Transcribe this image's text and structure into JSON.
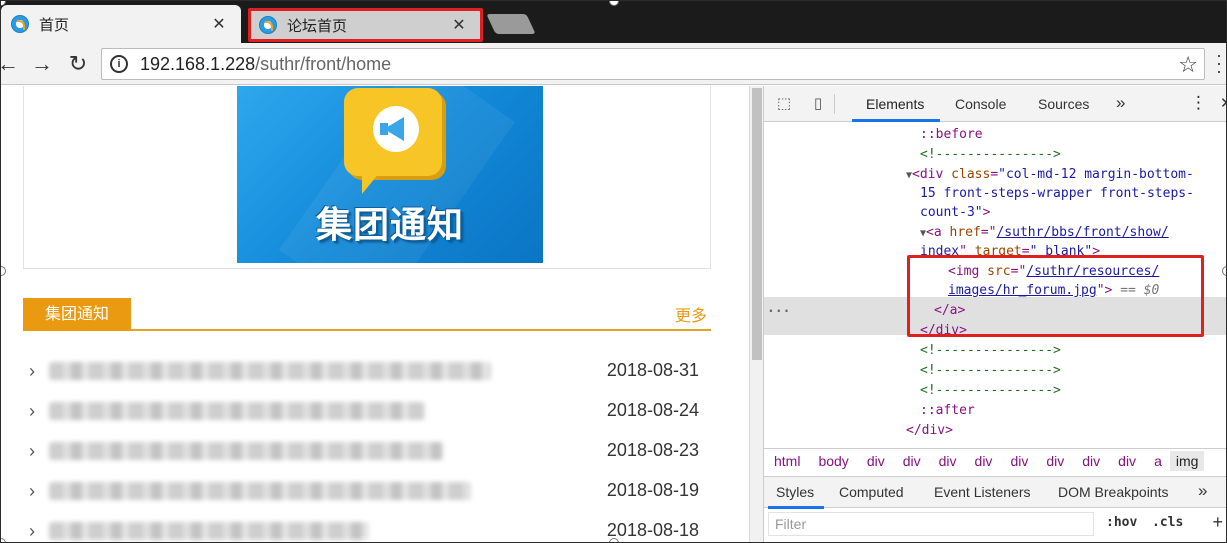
{
  "browser": {
    "tabs": [
      {
        "title": "首页",
        "active": true
      },
      {
        "title": "论坛首页",
        "active": false
      }
    ],
    "address": {
      "host": "192.168.1.228",
      "path": "/suthr/front/home"
    },
    "nav": {
      "back": "←",
      "forward": "→",
      "reload": "↻",
      "info": "i",
      "star": "☆",
      "close": "✕"
    }
  },
  "page": {
    "banner": {
      "label": "集团通知"
    },
    "section": {
      "title": "集团通知",
      "more": "更多"
    },
    "news": [
      {
        "date": "2018-08-31"
      },
      {
        "date": "2018-08-24"
      },
      {
        "date": "2018-08-23"
      },
      {
        "date": "2018-08-19"
      },
      {
        "date": "2018-08-18"
      }
    ]
  },
  "devtools": {
    "tabs": [
      "Elements",
      "Console",
      "Sources"
    ],
    "more_tabs": "»",
    "menu": "⋮",
    "close": "✕",
    "dom": {
      "before": "::before",
      "comment": "<!--------------->",
      "div_open_1": "<div ",
      "div_class_attr": "class",
      "div_class_val_1": "\"col-md-12 margin-bottom-",
      "div_class_val_2": "15 front-steps-wrapper front-steps-",
      "div_class_val_3": "count-3\"",
      "div_gt": ">",
      "a_open": "<a ",
      "href_attr": "href",
      "href_val_1": "/suthr/bbs/front/show/",
      "href_val_2": "index",
      "target_attr": "target",
      "target_val": "\"_blank\"",
      "img_open": "<img ",
      "src_attr": "src",
      "src_val_1": "/suthr/resources/",
      "src_val_2": "images/hr_forum.jpg",
      "eq_sel": "== $0",
      "a_close": "</a>",
      "div_close": "</div>",
      "after": "::after",
      "div_close_2": "</div>",
      "ellipsis": "..."
    },
    "breadcrumbs": [
      "html",
      "body",
      "div",
      "div",
      "div",
      "div",
      "div",
      "div",
      "div",
      "div",
      "a",
      "img"
    ],
    "style_tabs": [
      "Styles",
      "Computed",
      "Event Listeners",
      "DOM Breakpoints"
    ],
    "style_more": "»",
    "filter": {
      "placeholder": "Filter",
      "hov": ":hov",
      "cls": ".cls",
      "plus": "+"
    }
  }
}
